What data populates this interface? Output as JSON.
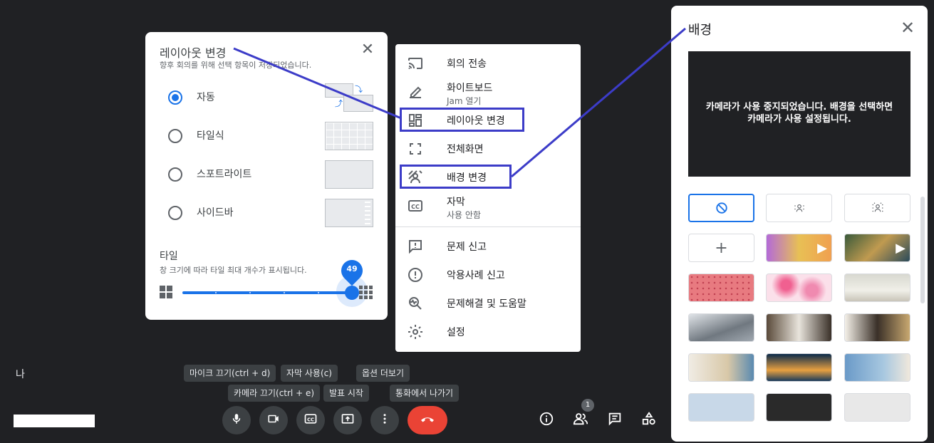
{
  "layout_dialog": {
    "title": "레이아웃 변경",
    "subtitle": "향후 회의를 위해 선택 항목이 저장되었습니다.",
    "options": [
      {
        "label": "자동",
        "selected": true
      },
      {
        "label": "타일식",
        "selected": false
      },
      {
        "label": "스포트라이트",
        "selected": false
      },
      {
        "label": "사이드바",
        "selected": false
      }
    ],
    "tiles_label": "타일",
    "tiles_desc": "창 크기에 따라 타일 최대 개수가 표시됩니다.",
    "tiles_value": "49",
    "close_icon": "close-icon",
    "accent_color": "#1a73e8"
  },
  "menu": {
    "items": [
      {
        "label": "회의 전송",
        "icon": "cast-icon"
      },
      {
        "label": "화이트보드",
        "sub": "Jam 열기",
        "icon": "pencil-icon"
      },
      {
        "label": "레이아웃 변경",
        "icon": "layout-icon"
      },
      {
        "label": "전체화면",
        "icon": "fullscreen-icon"
      },
      {
        "label": "배경 변경",
        "icon": "background-icon"
      },
      {
        "label": "자막",
        "sub": "사용 안함",
        "icon": "captions-icon"
      },
      {
        "label": "문제 신고",
        "icon": "feedback-icon"
      },
      {
        "label": "악용사례 신고",
        "icon": "report-icon"
      },
      {
        "label": "문제해결 및 도움말",
        "icon": "troubleshoot-icon"
      },
      {
        "label": "설정",
        "icon": "settings-icon"
      }
    ],
    "highlight_color": "#3c3cc8"
  },
  "background_panel": {
    "title": "배경",
    "preview_text_line1": "카메라가 사용 중지되었습니다. 배경을 선택하면",
    "preview_text_line2": "카메라가 사용 설정됩니다."
  },
  "bottom_bar": {
    "self_label": "나",
    "tooltips": {
      "mic": "마이크 끄기(ctrl + d)",
      "captions": "자막 사용(c)",
      "more": "옵션 더보기",
      "camera": "카메라 끄기(ctrl + e)",
      "present": "발표 시작",
      "leave": "통화에서 나가기"
    },
    "people_count": "1",
    "hangup_color": "#ea4335"
  }
}
